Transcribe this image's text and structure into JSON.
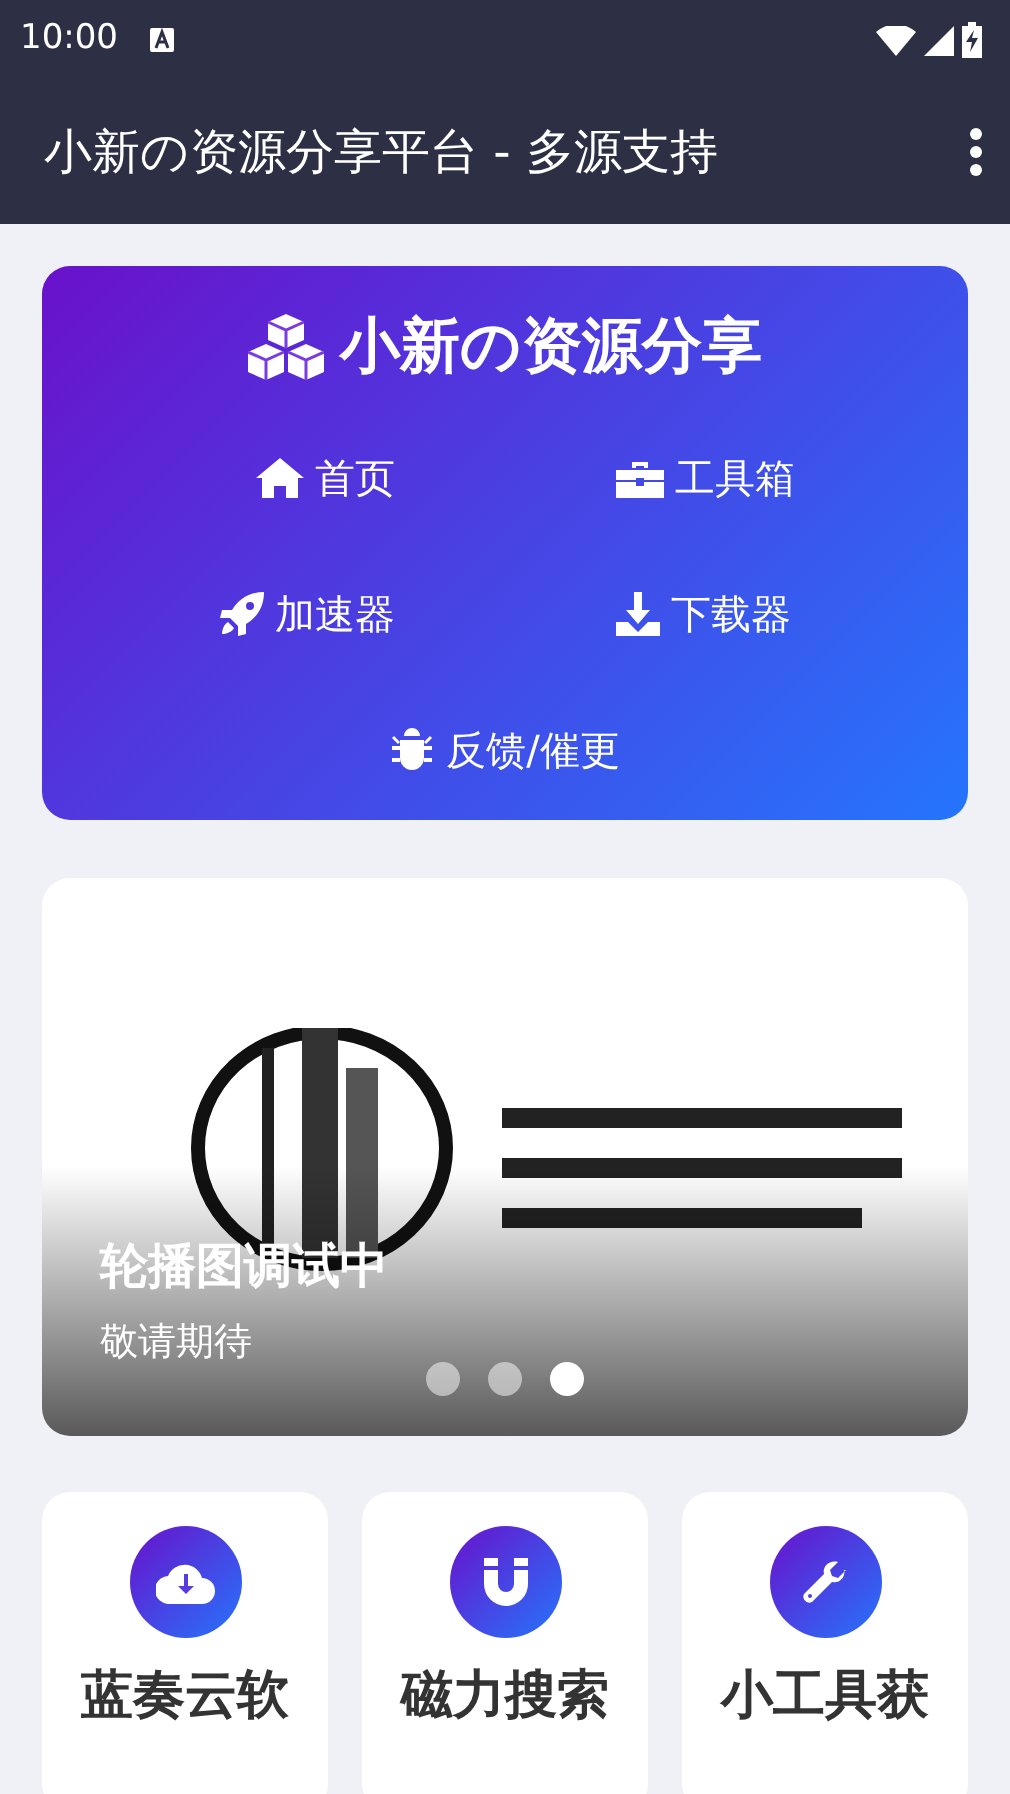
{
  "status_bar": {
    "time": "10:00"
  },
  "app_bar": {
    "title": "小新の资源分享平台 - 多源支持"
  },
  "hero": {
    "title": "小新の资源分享",
    "links": [
      {
        "label": "首页",
        "kind": "home"
      },
      {
        "label": "工具箱",
        "kind": "toolbox"
      },
      {
        "label": "加速器",
        "kind": "rocket"
      },
      {
        "label": "下载器",
        "kind": "download"
      },
      {
        "label": "反馈/催更",
        "kind": "bug"
      }
    ]
  },
  "carousel": {
    "caption_title": "轮播图调试中",
    "caption_text": "敬请期待",
    "indicators": [
      {
        "selected": false
      },
      {
        "selected": false
      },
      {
        "selected": true
      }
    ]
  },
  "features": [
    {
      "label": "蓝奏云软",
      "kind": "cloud"
    },
    {
      "label": "磁力搜索",
      "kind": "magnet"
    },
    {
      "label": "小工具获",
      "kind": "wrench"
    }
  ]
}
